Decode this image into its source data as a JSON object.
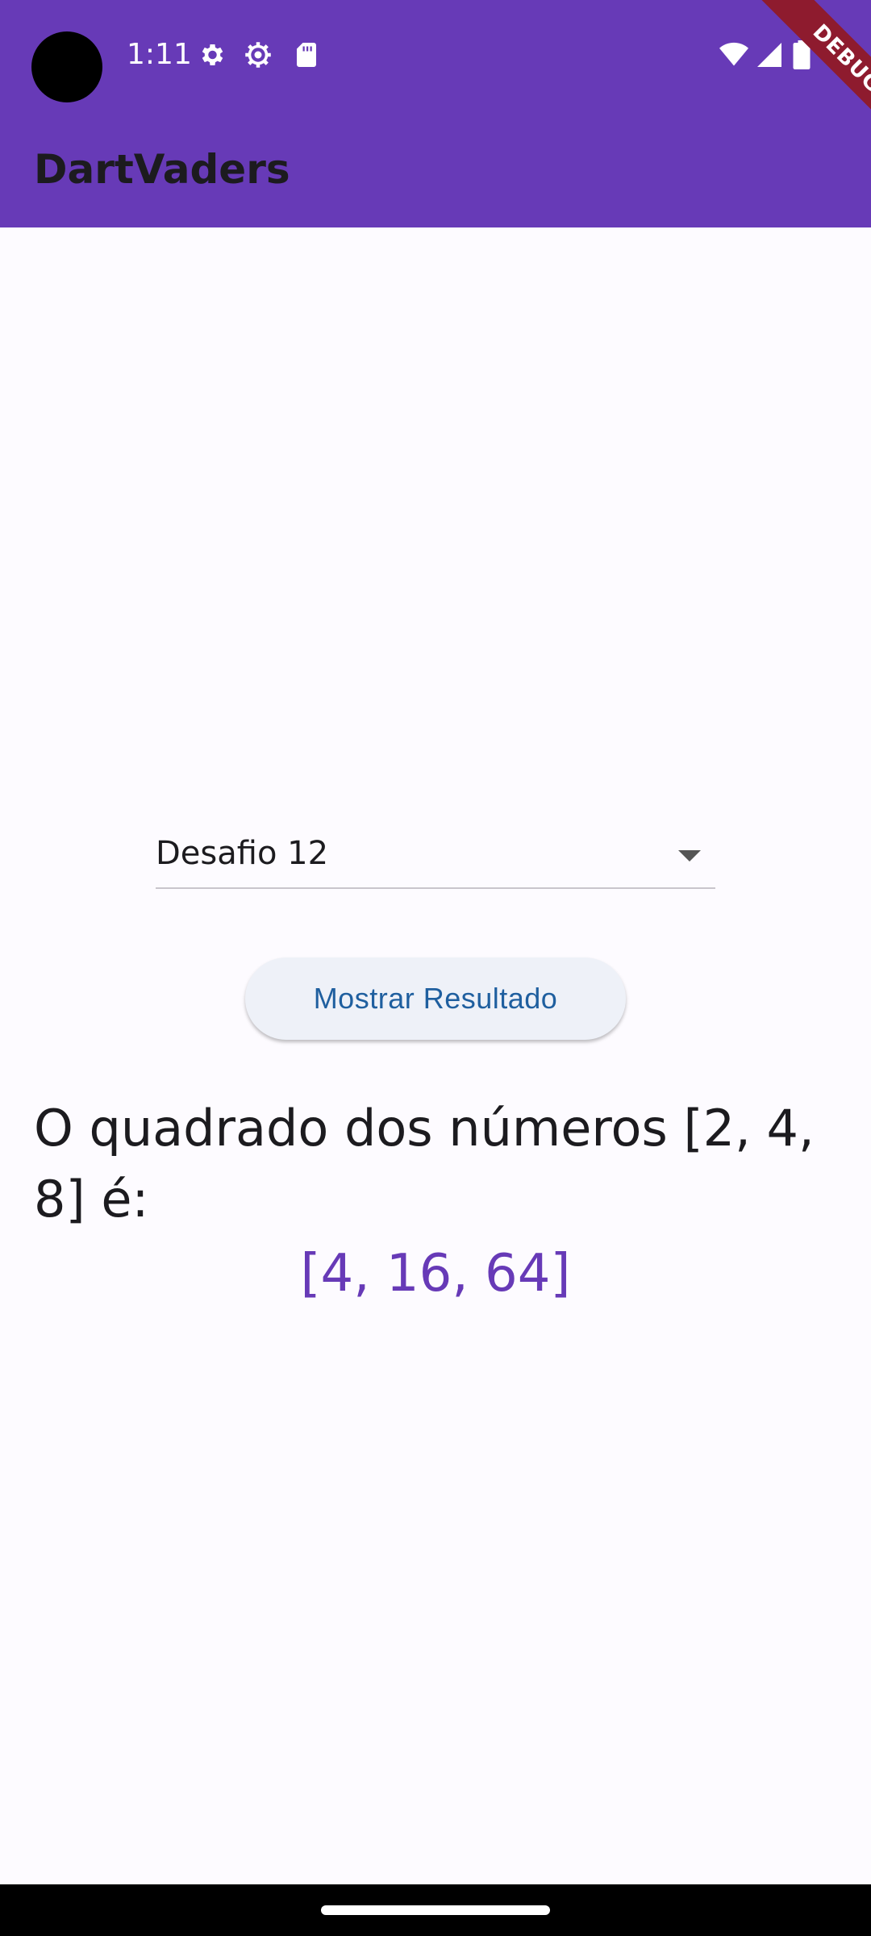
{
  "status_bar": {
    "time": "1:11",
    "icons": [
      "settings-icon",
      "settings-outline-icon",
      "sd-card-icon",
      "wifi-icon",
      "cellular-icon",
      "battery-icon"
    ]
  },
  "app_bar": {
    "title": "DartVaders",
    "background_color": "#673ab7"
  },
  "debug_banner": {
    "label": "DEBUG",
    "color": "#8e1b2e"
  },
  "dropdown": {
    "selected": "Desafio 12"
  },
  "action_button": {
    "label": "Mostrar Resultado"
  },
  "result": {
    "question": "O quadrado dos números [2, 4, 8] é:",
    "answer": "[4, 16, 64]",
    "answer_color": "#673ab7"
  }
}
